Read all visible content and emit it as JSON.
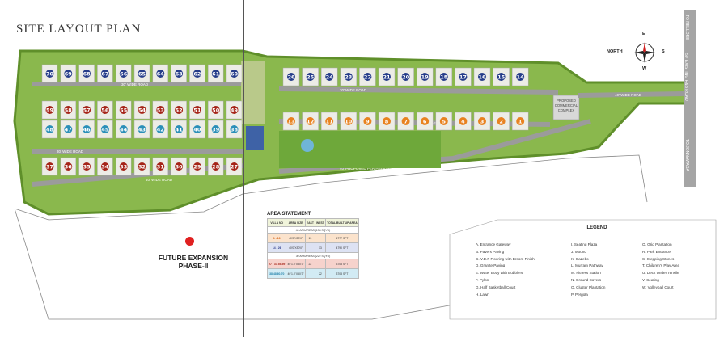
{
  "title": "SITE LAYOUT PLAN",
  "colors": {
    "green": "#86b64a",
    "plot_blue": "#263d8a",
    "plot_orange": "#e88220",
    "plot_red": "#a52418",
    "plot_teal": "#2b8fb8",
    "road": "#9b9b9b",
    "marker": "#e02020"
  },
  "plots": {
    "top_left": [
      "70",
      "69",
      "68",
      "67",
      "66",
      "65",
      "64",
      "63",
      "62",
      "61",
      "60"
    ],
    "top_right": [
      "26",
      "25",
      "24",
      "23",
      "22",
      "21",
      "20",
      "19",
      "18",
      "17",
      "16",
      "15",
      "14"
    ],
    "mid_right": [
      "13",
      "12",
      "11",
      "10",
      "9",
      "8",
      "7",
      "6",
      "5",
      "4",
      "3",
      "2",
      "1"
    ],
    "row3": [
      "59",
      "58",
      "57",
      "56",
      "55",
      "54",
      "53",
      "52",
      "51",
      "50",
      "49"
    ],
    "row4": [
      "48",
      "47",
      "46",
      "45",
      "44",
      "43",
      "42",
      "41",
      "40",
      "39",
      "38"
    ],
    "bottom": [
      "37",
      "36",
      "35",
      "34",
      "33",
      "32",
      "31",
      "30",
      "29",
      "28",
      "27"
    ]
  },
  "roads": {
    "r1": "30' WIDE ROAD",
    "r2": "30' WIDE ROAD",
    "r3": "30' WIDE ROAD",
    "r4": "40' WIDE ROAD",
    "r5": "30' WIDE ROAD",
    "r6": "40' WIDE ROAD",
    "r7": "40' PROPOSED PERIPHERAL ROAD",
    "to_nellore": "TO NELLORE",
    "existing": "50' EXISTING R&B ROAD",
    "to_jonnawada": "TO JONNAWADA"
  },
  "complex": "PROPOSED COMMERCIAL COMPLEX",
  "compass": {
    "n": "N",
    "north": "NORTH",
    "e": "E",
    "s": "S",
    "w": "W"
  },
  "future": {
    "line1": "FUTURE EXPANSION",
    "line2": "PHASE-II"
  },
  "area_statement": {
    "title": "AREA STATEMENT",
    "headers": [
      "VILLA NO",
      "AREA SIZE",
      "EAST",
      "WEST",
      "TOTAL BUILT UP AREA"
    ],
    "sub1": "40 ARKAREAS (198 SQYD)",
    "sub2": "30 ARKAREAS (222 SQYD)",
    "rows": [
      {
        "villa": "1 - 13",
        "size": "40'0\"X50'0\"",
        "east": "13",
        "west": "",
        "total": "4777 SFT"
      },
      {
        "villa": "14 - 26",
        "size": "40'0\"X50'0\"",
        "east": "",
        "west": "13",
        "total": "4790 SFT"
      },
      {
        "villa": "27 - 37 49-59",
        "size": "40'1.5\"X50'3\"",
        "east": "22",
        "west": "",
        "total": "3708 SFT"
      },
      {
        "villa": "38-48 60-70",
        "size": "40'1.5\"X50'3\"",
        "east": "",
        "west": "22",
        "total": "3708 SFT"
      }
    ]
  },
  "legend": {
    "title": "LEGEND",
    "col1": [
      "A. Entrance Gateway",
      "B. Pavers Paving",
      "C. V.D.F Flooring with Broom  Finish",
      "D. Granite Paving",
      "E. Water Body with Bubblers",
      "F. Pylon",
      "G. Half Basketball Court",
      "H. Lawn"
    ],
    "col2": [
      "I. Seating Plaza",
      "J. Mound",
      "K. Gazebo",
      "L. Murram Pathway",
      "M. Fitness Station",
      "N. Ground Covers",
      "O. Cluster Plantation",
      "P. Pergola"
    ],
    "col3": [
      "Q. Grid Plantation",
      "R. Park Entrance",
      "S. Stepping Stones",
      "T. Children's Play Area",
      "U. Deck Under Tensile",
      "V. Seating",
      "W. Volleyball  Court"
    ]
  }
}
